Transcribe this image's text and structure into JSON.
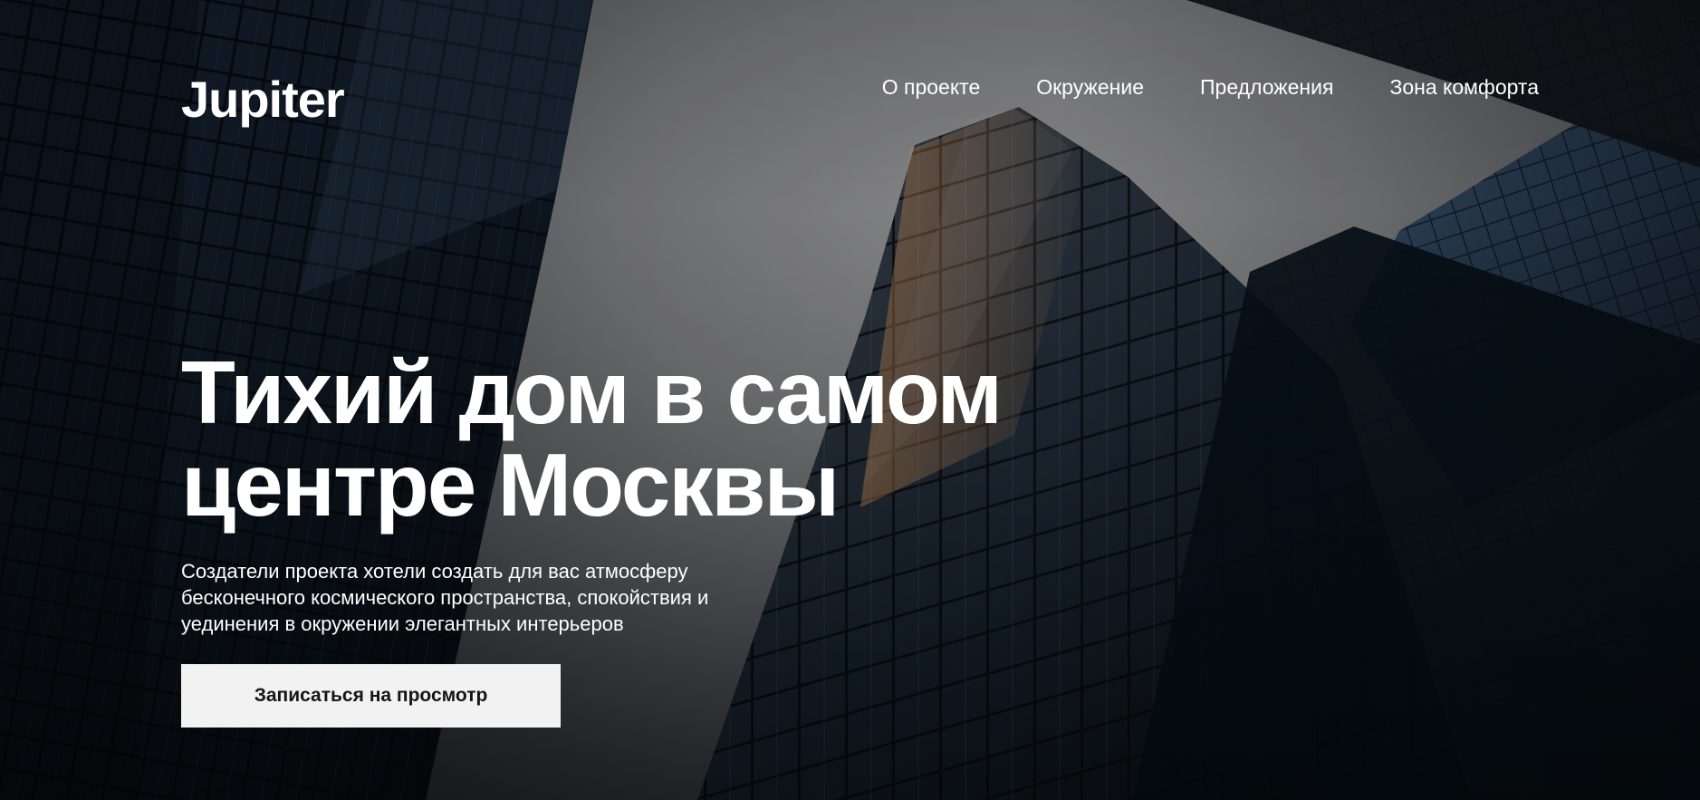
{
  "brand": {
    "logo_text": "Jupiter"
  },
  "nav": {
    "items": [
      {
        "label": "О проекте"
      },
      {
        "label": "Окружение"
      },
      {
        "label": "Предложения"
      },
      {
        "label": "Зона комфорта"
      }
    ]
  },
  "hero": {
    "title_line_1": "Тихий дом в самом",
    "title_line_2": "центре Москвы",
    "subtitle": "Создатели проекта хотели создать для вас атмосферу бесконечного космического пространства, спокойствия и уединения в окружении элегантных интерьеров",
    "cta_label": "Записаться на просмотр"
  },
  "colors": {
    "text": "#ffffff",
    "button_background": "#f2f2f2",
    "button_text": "#151515",
    "sky": "#77787b"
  },
  "icons": {
    "hero_image": "city-skyscrapers-background"
  }
}
